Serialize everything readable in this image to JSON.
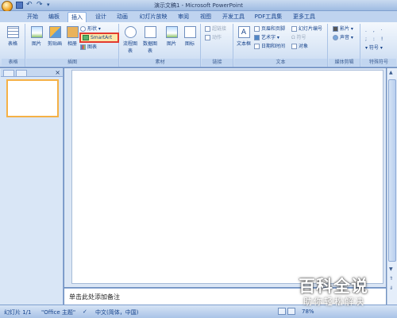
{
  "window": {
    "title": "演示文稿1 - Microsoft PowerPoint"
  },
  "tabs": [
    "开始",
    "编板",
    "插入",
    "设计",
    "动画",
    "幻灯片放映",
    "审阅",
    "视图",
    "开发工具",
    "PDF工具集",
    "更多工具"
  ],
  "active_tab": "插入",
  "ribbon": {
    "groups": {
      "table": "表格",
      "illustrations": "插图",
      "media_clips": "素材",
      "links": "链接",
      "text": "文本",
      "media": "媒体剪辑",
      "symbols": "特殊符号"
    },
    "buttons": {
      "table": "表格",
      "picture": "图片",
      "clipart": "剪贴画",
      "album": "相册",
      "shapes": "形状",
      "smartart": "SmartArt",
      "chart": "图表",
      "flowchart": "流程图表",
      "data_chart": "数据图表",
      "pic2": "图片",
      "icon": "图标",
      "hyperlink": "超链接",
      "action": "动作",
      "textbox": "文本框",
      "header_footer": "页眉和页脚",
      "wordart": "艺术字",
      "datetime": "日期和时间",
      "slide_number": "幻灯片编号",
      "symbol": "符号",
      "object": "对象",
      "movie": "影片",
      "sound": "声音",
      "symbol2": "符号"
    }
  },
  "notes_placeholder": "单击此处添加备注",
  "status": {
    "slide": "幻灯片 1/1",
    "theme": "\"Office 主题\"",
    "language": "中文(简体，中国)",
    "zoom": "78%"
  },
  "watermark": {
    "main": "百科全说",
    "sub": "助你轻松解决"
  }
}
